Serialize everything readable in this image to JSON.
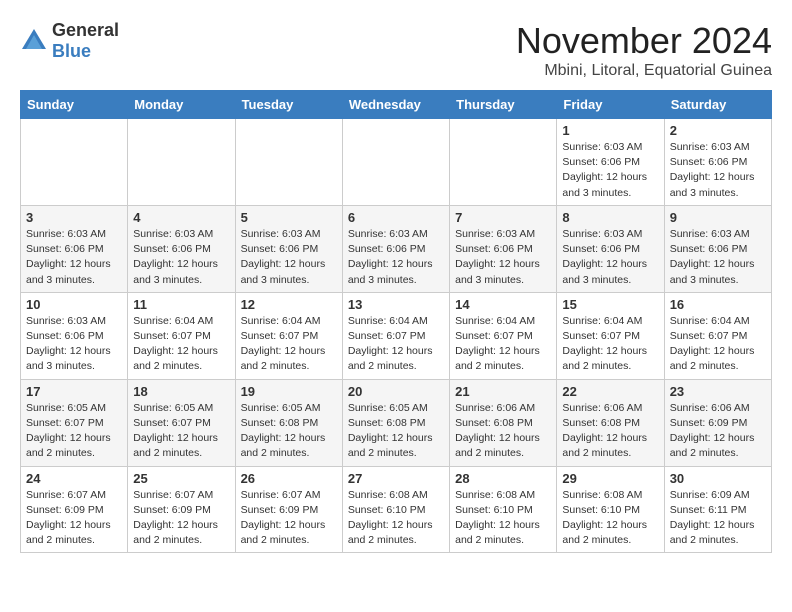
{
  "logo": {
    "general": "General",
    "blue": "Blue"
  },
  "title": "November 2024",
  "location": "Mbini, Litoral, Equatorial Guinea",
  "weekdays": [
    "Sunday",
    "Monday",
    "Tuesday",
    "Wednesday",
    "Thursday",
    "Friday",
    "Saturday"
  ],
  "weeks": [
    [
      {
        "day": "",
        "info": ""
      },
      {
        "day": "",
        "info": ""
      },
      {
        "day": "",
        "info": ""
      },
      {
        "day": "",
        "info": ""
      },
      {
        "day": "",
        "info": ""
      },
      {
        "day": "1",
        "info": "Sunrise: 6:03 AM\nSunset: 6:06 PM\nDaylight: 12 hours\nand 3 minutes."
      },
      {
        "day": "2",
        "info": "Sunrise: 6:03 AM\nSunset: 6:06 PM\nDaylight: 12 hours\nand 3 minutes."
      }
    ],
    [
      {
        "day": "3",
        "info": "Sunrise: 6:03 AM\nSunset: 6:06 PM\nDaylight: 12 hours\nand 3 minutes."
      },
      {
        "day": "4",
        "info": "Sunrise: 6:03 AM\nSunset: 6:06 PM\nDaylight: 12 hours\nand 3 minutes."
      },
      {
        "day": "5",
        "info": "Sunrise: 6:03 AM\nSunset: 6:06 PM\nDaylight: 12 hours\nand 3 minutes."
      },
      {
        "day": "6",
        "info": "Sunrise: 6:03 AM\nSunset: 6:06 PM\nDaylight: 12 hours\nand 3 minutes."
      },
      {
        "day": "7",
        "info": "Sunrise: 6:03 AM\nSunset: 6:06 PM\nDaylight: 12 hours\nand 3 minutes."
      },
      {
        "day": "8",
        "info": "Sunrise: 6:03 AM\nSunset: 6:06 PM\nDaylight: 12 hours\nand 3 minutes."
      },
      {
        "day": "9",
        "info": "Sunrise: 6:03 AM\nSunset: 6:06 PM\nDaylight: 12 hours\nand 3 minutes."
      }
    ],
    [
      {
        "day": "10",
        "info": "Sunrise: 6:03 AM\nSunset: 6:06 PM\nDaylight: 12 hours\nand 3 minutes."
      },
      {
        "day": "11",
        "info": "Sunrise: 6:04 AM\nSunset: 6:07 PM\nDaylight: 12 hours\nand 2 minutes."
      },
      {
        "day": "12",
        "info": "Sunrise: 6:04 AM\nSunset: 6:07 PM\nDaylight: 12 hours\nand 2 minutes."
      },
      {
        "day": "13",
        "info": "Sunrise: 6:04 AM\nSunset: 6:07 PM\nDaylight: 12 hours\nand 2 minutes."
      },
      {
        "day": "14",
        "info": "Sunrise: 6:04 AM\nSunset: 6:07 PM\nDaylight: 12 hours\nand 2 minutes."
      },
      {
        "day": "15",
        "info": "Sunrise: 6:04 AM\nSunset: 6:07 PM\nDaylight: 12 hours\nand 2 minutes."
      },
      {
        "day": "16",
        "info": "Sunrise: 6:04 AM\nSunset: 6:07 PM\nDaylight: 12 hours\nand 2 minutes."
      }
    ],
    [
      {
        "day": "17",
        "info": "Sunrise: 6:05 AM\nSunset: 6:07 PM\nDaylight: 12 hours\nand 2 minutes."
      },
      {
        "day": "18",
        "info": "Sunrise: 6:05 AM\nSunset: 6:07 PM\nDaylight: 12 hours\nand 2 minutes."
      },
      {
        "day": "19",
        "info": "Sunrise: 6:05 AM\nSunset: 6:08 PM\nDaylight: 12 hours\nand 2 minutes."
      },
      {
        "day": "20",
        "info": "Sunrise: 6:05 AM\nSunset: 6:08 PM\nDaylight: 12 hours\nand 2 minutes."
      },
      {
        "day": "21",
        "info": "Sunrise: 6:06 AM\nSunset: 6:08 PM\nDaylight: 12 hours\nand 2 minutes."
      },
      {
        "day": "22",
        "info": "Sunrise: 6:06 AM\nSunset: 6:08 PM\nDaylight: 12 hours\nand 2 minutes."
      },
      {
        "day": "23",
        "info": "Sunrise: 6:06 AM\nSunset: 6:09 PM\nDaylight: 12 hours\nand 2 minutes."
      }
    ],
    [
      {
        "day": "24",
        "info": "Sunrise: 6:07 AM\nSunset: 6:09 PM\nDaylight: 12 hours\nand 2 minutes."
      },
      {
        "day": "25",
        "info": "Sunrise: 6:07 AM\nSunset: 6:09 PM\nDaylight: 12 hours\nand 2 minutes."
      },
      {
        "day": "26",
        "info": "Sunrise: 6:07 AM\nSunset: 6:09 PM\nDaylight: 12 hours\nand 2 minutes."
      },
      {
        "day": "27",
        "info": "Sunrise: 6:08 AM\nSunset: 6:10 PM\nDaylight: 12 hours\nand 2 minutes."
      },
      {
        "day": "28",
        "info": "Sunrise: 6:08 AM\nSunset: 6:10 PM\nDaylight: 12 hours\nand 2 minutes."
      },
      {
        "day": "29",
        "info": "Sunrise: 6:08 AM\nSunset: 6:10 PM\nDaylight: 12 hours\nand 2 minutes."
      },
      {
        "day": "30",
        "info": "Sunrise: 6:09 AM\nSunset: 6:11 PM\nDaylight: 12 hours\nand 2 minutes."
      }
    ]
  ]
}
